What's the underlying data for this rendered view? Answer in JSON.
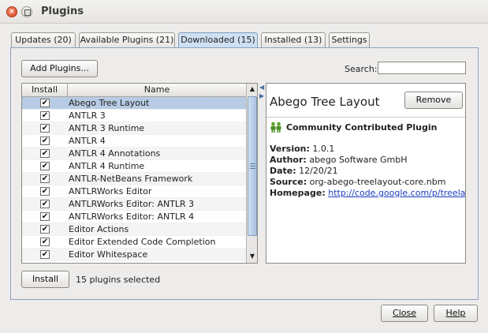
{
  "window": {
    "title": "Plugins"
  },
  "tabs": [
    {
      "label": "Updates (20)",
      "active": false
    },
    {
      "label": "Available Plugins (21)",
      "active": false
    },
    {
      "label": "Downloaded (15)",
      "active": true
    },
    {
      "label": "Installed (13)",
      "active": false
    },
    {
      "label": "Settings",
      "active": false
    }
  ],
  "toolbar": {
    "add_plugins_label": "Add Plugins...",
    "search_label": "Search:",
    "search_value": ""
  },
  "table": {
    "columns": [
      "Install",
      "Name"
    ],
    "rows": [
      {
        "name": "Abego Tree Layout",
        "checked": true,
        "selected": true
      },
      {
        "name": "ANTLR 3",
        "checked": true
      },
      {
        "name": "ANTLR 3 Runtime",
        "checked": true
      },
      {
        "name": "ANTLR 4",
        "checked": true
      },
      {
        "name": "ANTLR 4 Annotations",
        "checked": true
      },
      {
        "name": "ANTLR 4 Runtime",
        "checked": true
      },
      {
        "name": "ANTLR-NetBeans Framework",
        "checked": true
      },
      {
        "name": "ANTLRWorks Editor",
        "checked": true
      },
      {
        "name": "ANTLRWorks Editor: ANTLR 3",
        "checked": true
      },
      {
        "name": "ANTLRWorks Editor: ANTLR 4",
        "checked": true
      },
      {
        "name": "Editor Actions",
        "checked": true
      },
      {
        "name": "Editor Extended Code Completion",
        "checked": true
      },
      {
        "name": "Editor Whitespace",
        "checked": true
      }
    ]
  },
  "detail": {
    "title": "Abego Tree Layout",
    "remove_label": "Remove",
    "badge": "Community Contributed Plugin",
    "version_label": "Version:",
    "version": "1.0.1",
    "author_label": "Author:",
    "author": "abego Software GmbH",
    "date_label": "Date:",
    "date": "12/20/21",
    "source_label": "Source:",
    "source": "org-abego-treelayout-core.nbm",
    "homepage_label": "Homepage:",
    "homepage": "http://code.google.com/p/treelayout/"
  },
  "footer": {
    "install_label": "Install",
    "status": "15 plugins selected"
  },
  "dialog": {
    "close_label": "Close",
    "help_label": "Help"
  },
  "colors": {
    "selection": "#b7cce4",
    "tab_active": "#cfe0f2",
    "link": "#1b3dbf"
  }
}
